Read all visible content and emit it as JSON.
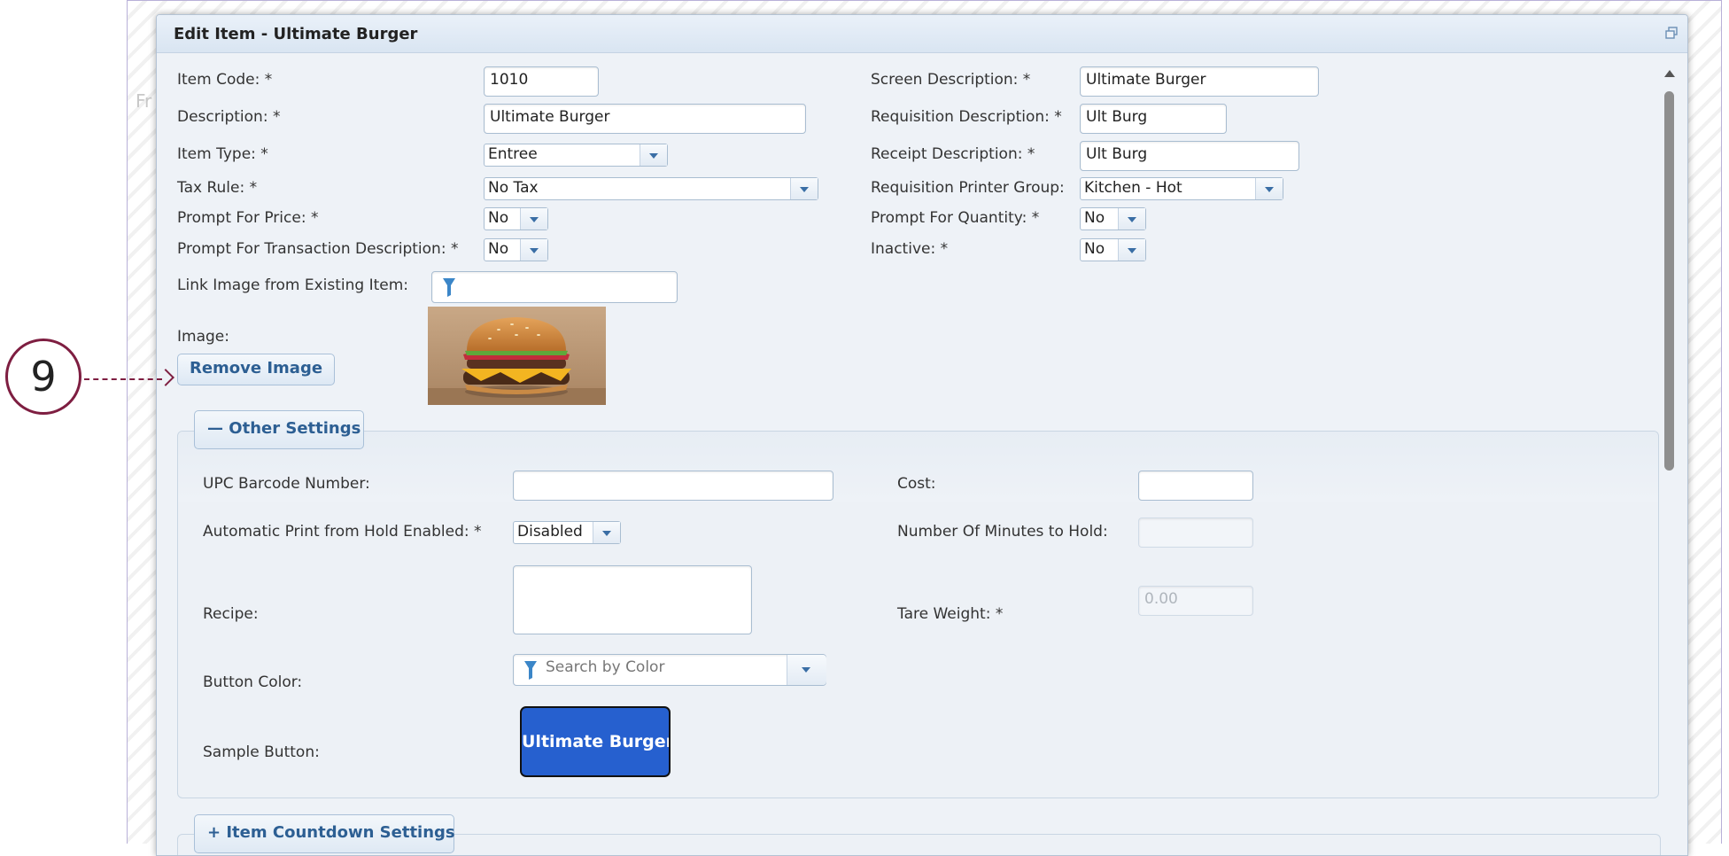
{
  "background": {
    "partial_text": "Fr"
  },
  "callout": {
    "number": "9"
  },
  "dialog": {
    "title": "Edit Item - Ultimate Burger",
    "restore_icon": "restore-window-icon"
  },
  "form": {
    "item_code": {
      "label": "Item Code: *",
      "value": "1010"
    },
    "description": {
      "label": "Description: *",
      "value": "Ultimate Burger"
    },
    "item_type": {
      "label": "Item Type: *",
      "value": "Entree"
    },
    "tax_rule": {
      "label": "Tax Rule: *",
      "value": "No Tax"
    },
    "prompt_price": {
      "label": "Prompt For Price: *",
      "value": "No"
    },
    "prompt_transaction": {
      "label": "Prompt For Transaction Description: *",
      "value": "No"
    },
    "link_image": {
      "label": "Link Image from Existing Item:",
      "value": ""
    },
    "image": {
      "label": "Image:",
      "remove_label": "Remove Image"
    },
    "screen_description": {
      "label": "Screen Description: *",
      "value": "Ultimate Burger"
    },
    "requisition_description": {
      "label": "Requisition Description: *",
      "value": "Ult Burg"
    },
    "receipt_description": {
      "label": "Receipt Description: *",
      "value": "Ult Burg"
    },
    "printer_group": {
      "label": "Requisition Printer Group:",
      "value": "Kitchen - Hot"
    },
    "prompt_quantity": {
      "label": "Prompt For Quantity: *",
      "value": "No"
    },
    "inactive": {
      "label": "Inactive: *",
      "value": "No"
    }
  },
  "other_settings": {
    "legend": "Other Settings",
    "legend_icon": "minus",
    "upc": {
      "label": "UPC Barcode Number:",
      "value": ""
    },
    "cost": {
      "label": "Cost:",
      "value": ""
    },
    "auto_print": {
      "label": "Automatic Print from Hold Enabled: *",
      "value": "Disabled"
    },
    "minutes_hold": {
      "label": "Number Of Minutes to Hold:",
      "value": ""
    },
    "recipe": {
      "label": "Recipe:",
      "value": ""
    },
    "tare_weight": {
      "label": "Tare Weight: *",
      "value": "0.00"
    },
    "button_color": {
      "label": "Button Color:",
      "placeholder": "Search by Color"
    },
    "sample_button": {
      "label": "Sample Button:",
      "text": "Ultimate Burger",
      "color": "#2660cf"
    }
  },
  "countdown_settings": {
    "legend": "Item Countdown Settings",
    "legend_icon": "plus"
  },
  "colors": {
    "accent": "#2d5f93",
    "callout": "#7e1e41",
    "dialog_bg": "#eef2f7"
  }
}
